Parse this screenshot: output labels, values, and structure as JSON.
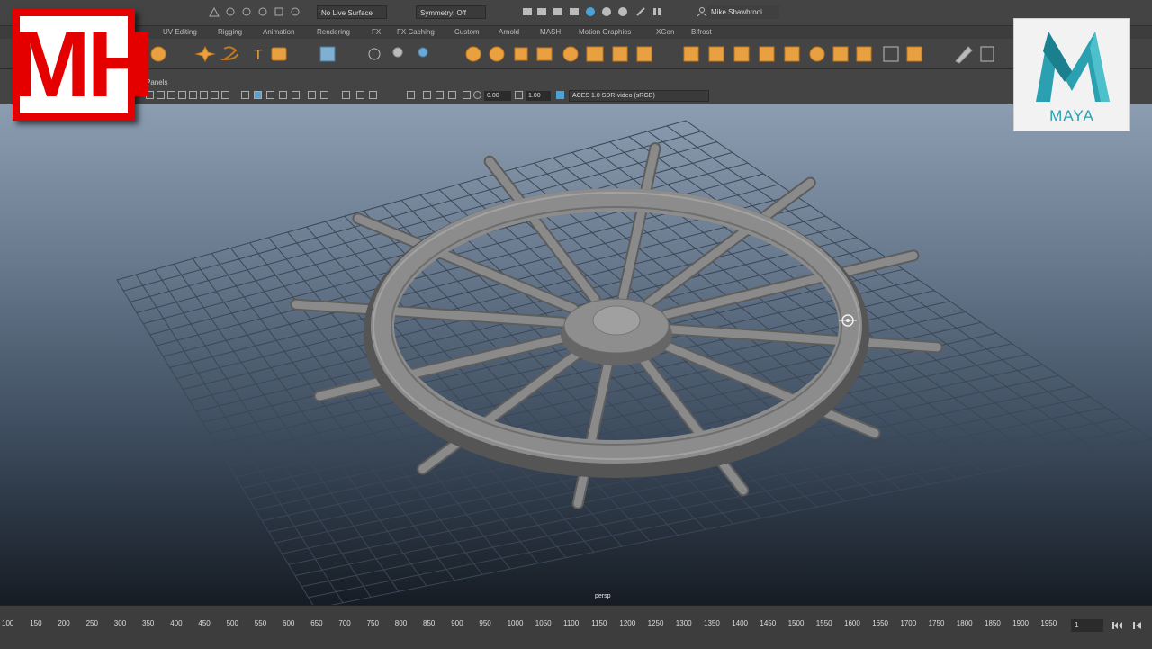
{
  "statusline": {
    "live_surface": "No Live Surface",
    "symmetry": "Symmetry: Off",
    "user": "Mike Shawbrooi"
  },
  "shelf_tabs": [
    "UV Editing",
    "Rigging",
    "Animation",
    "Rendering",
    "FX",
    "FX Caching",
    "Custom",
    "Arnold",
    "MASH",
    "Motion Graphics",
    "XGen",
    "Bifrost"
  ],
  "panel_menu": {
    "panels": "Panels"
  },
  "panel_toolbar": {
    "value1": "0.00",
    "value2": "1.00",
    "color_space": "ACES 1.0 SDR-video (sRGB)"
  },
  "viewport": {
    "camera_label": "persp"
  },
  "timeline": {
    "ticks": [
      "100",
      "150",
      "200",
      "250",
      "300",
      "350",
      "400",
      "450",
      "500",
      "550",
      "600",
      "650",
      "700",
      "750",
      "800",
      "850",
      "900",
      "950",
      "1000",
      "1050",
      "1100",
      "1150",
      "1200",
      "1250",
      "1300",
      "1350",
      "1400",
      "1450",
      "1500",
      "1550",
      "1600",
      "1650",
      "1700",
      "1750",
      "1800",
      "1850",
      "1900",
      "1950"
    ],
    "current_frame": "1"
  },
  "logos": {
    "mh": "MH",
    "maya": "MAYA"
  },
  "colors": {
    "icon_orange": "#e8a040",
    "mh_red": "#e50000",
    "maya_teal": "#2aa0b0"
  }
}
